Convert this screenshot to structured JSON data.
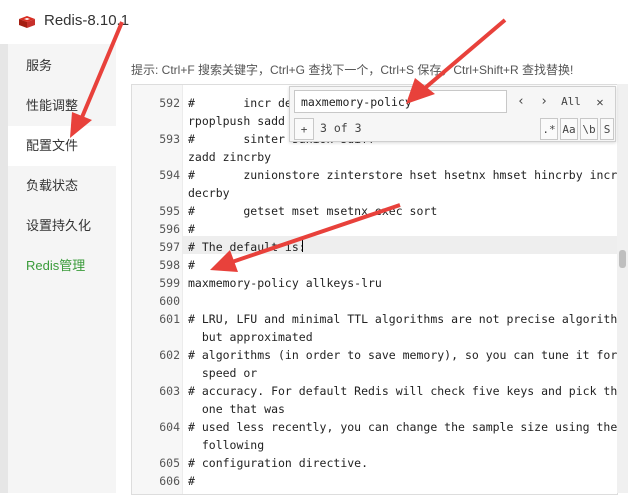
{
  "window": {
    "title": "Redis-8.10.1"
  },
  "sidebar": {
    "items": [
      {
        "label": "服务"
      },
      {
        "label": "性能调整"
      },
      {
        "label": "配置文件"
      },
      {
        "label": "负载状态"
      },
      {
        "label": "设置持久化"
      },
      {
        "label": "Redis管理"
      }
    ]
  },
  "hint": "提示: Ctrl+F 搜索关键字，Ctrl+G 查找下一个，Ctrl+S 保存，Ctrl+Shift+R 查找替换!",
  "editor": {
    "lines": [
      {
        "n": "",
        "t": "       "
      },
      {
        "n": "592",
        "t": "#       incr decr incrby decrby getset"
      },
      {
        "n": "",
        "t": "rpoplpush sadd"
      },
      {
        "n": "593",
        "t": "#       sinter sunion sdiff"
      },
      {
        "n": "",
        "t": "zadd zincrby"
      },
      {
        "n": "594",
        "t": "#       zunionstore zinterstore hset hsetnx hmset hincrby incrby"
      },
      {
        "n": "",
        "t": "decrby"
      },
      {
        "n": "595",
        "t": "#       getset mset msetnx exec sort"
      },
      {
        "n": "596",
        "t": "#"
      },
      {
        "n": "597",
        "t": "# The default is:"
      },
      {
        "n": "598",
        "t": "#"
      },
      {
        "n": "599",
        "t": "maxmemory-policy allkeys-lru"
      },
      {
        "n": "600",
        "t": ""
      },
      {
        "n": "601",
        "t": "# LRU, LFU and minimal TTL algorithms are not precise algorithms"
      },
      {
        "n": "",
        "t": "  but approximated"
      },
      {
        "n": "602",
        "t": "# algorithms (in order to save memory), so you can tune it for"
      },
      {
        "n": "",
        "t": "  speed or"
      },
      {
        "n": "603",
        "t": "# accuracy. For default Redis will check five keys and pick the"
      },
      {
        "n": "",
        "t": "  one that was"
      },
      {
        "n": "604",
        "t": "# used less recently, you can change the sample size using the"
      },
      {
        "n": "",
        "t": "  following"
      },
      {
        "n": "605",
        "t": "# configuration directive."
      },
      {
        "n": "606",
        "t": "#"
      }
    ]
  },
  "search": {
    "query": "maxmemory-policy",
    "all_label": "All",
    "count": "3 of 3",
    "plus_label": "+",
    "regex_label": ".*",
    "case_label": "Aa",
    "word_label": "\\b",
    "sel_label": "S",
    "close_label": "✕"
  }
}
